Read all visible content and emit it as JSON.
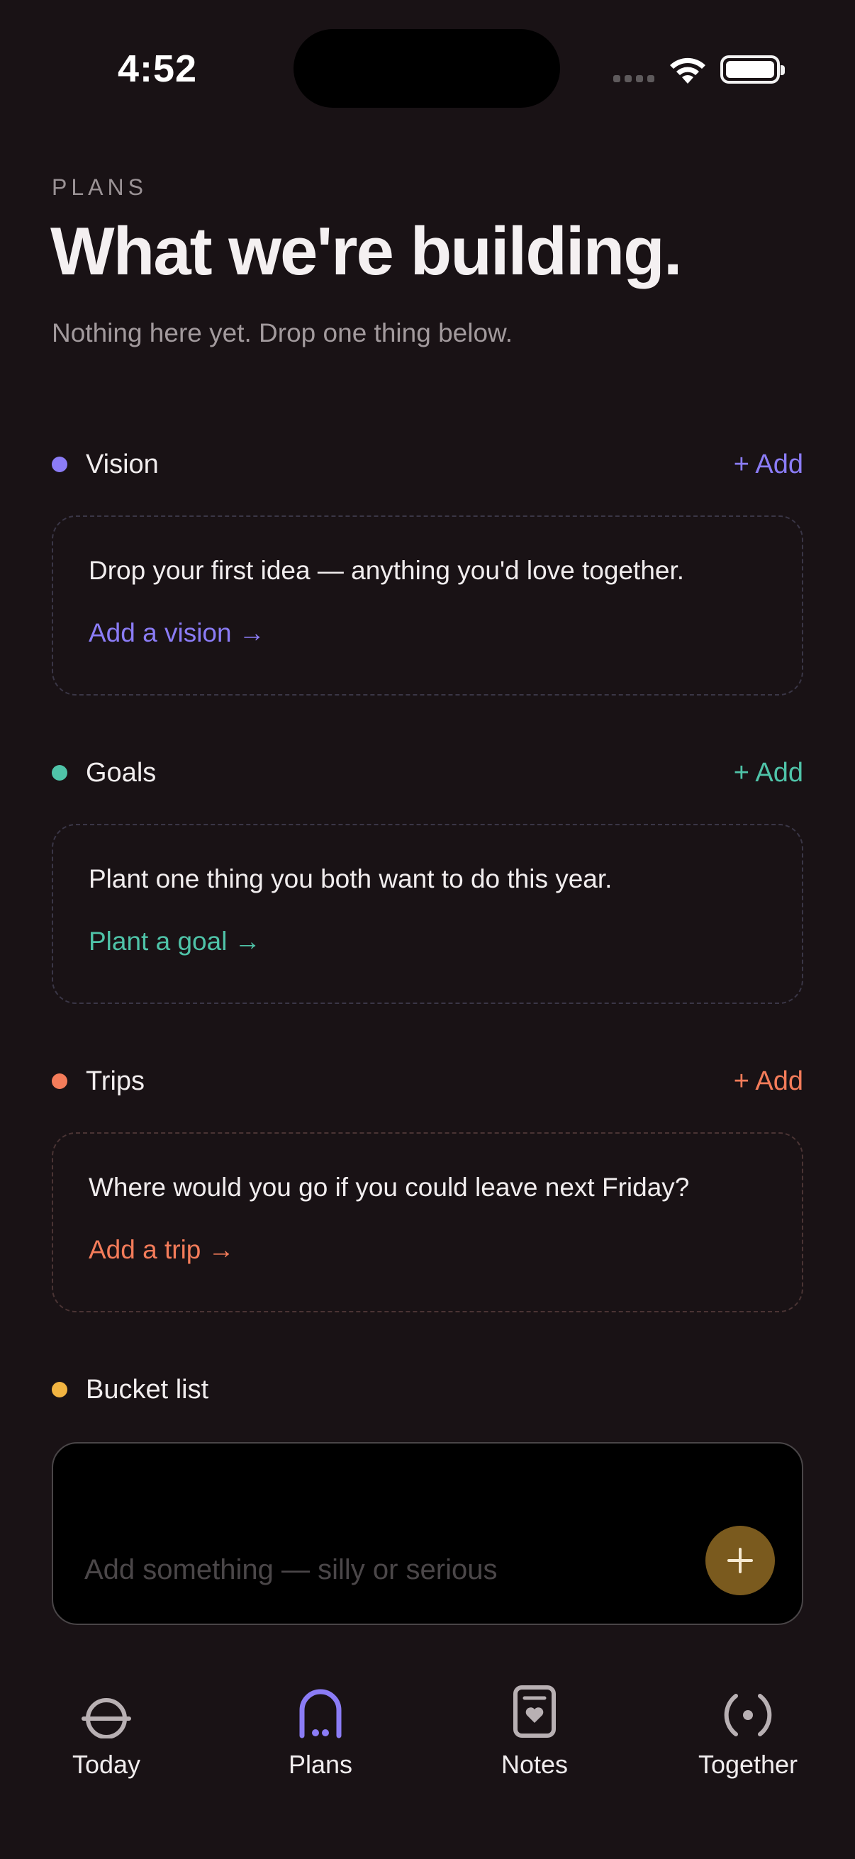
{
  "status_bar": {
    "time": "4:52"
  },
  "header": {
    "eyebrow": "PLANS",
    "title": "What we're building.",
    "subtitle": "Nothing here yet. Drop one thing below."
  },
  "sections": {
    "vision": {
      "name": "Vision",
      "add_label": "+ Add",
      "prompt": "Drop your first idea — anything you'd love together.",
      "cta": "Add a vision →",
      "color": "#8b7cf6"
    },
    "goals": {
      "name": "Goals",
      "add_label": "+ Add",
      "prompt": "Plant one thing you both want to do this year.",
      "cta": "Plant a goal →",
      "color": "#4fc3a8"
    },
    "trips": {
      "name": "Trips",
      "add_label": "+ Add",
      "prompt": "Where would you go if you could leave next Friday?",
      "cta": "Add a trip →",
      "color": "#f47c5a"
    },
    "bucket": {
      "name": "Bucket list",
      "placeholder": "Add something — silly or serious",
      "color": "#f2b441"
    }
  },
  "tabbar": {
    "items": [
      {
        "label": "Today",
        "icon": "today-icon"
      },
      {
        "label": "Plans",
        "icon": "plans-icon",
        "active": true
      },
      {
        "label": "Notes",
        "icon": "notes-icon"
      },
      {
        "label": "Together",
        "icon": "together-icon"
      }
    ],
    "active_color": "#8b7cf6",
    "inactive_color": "#b8b0b3"
  }
}
